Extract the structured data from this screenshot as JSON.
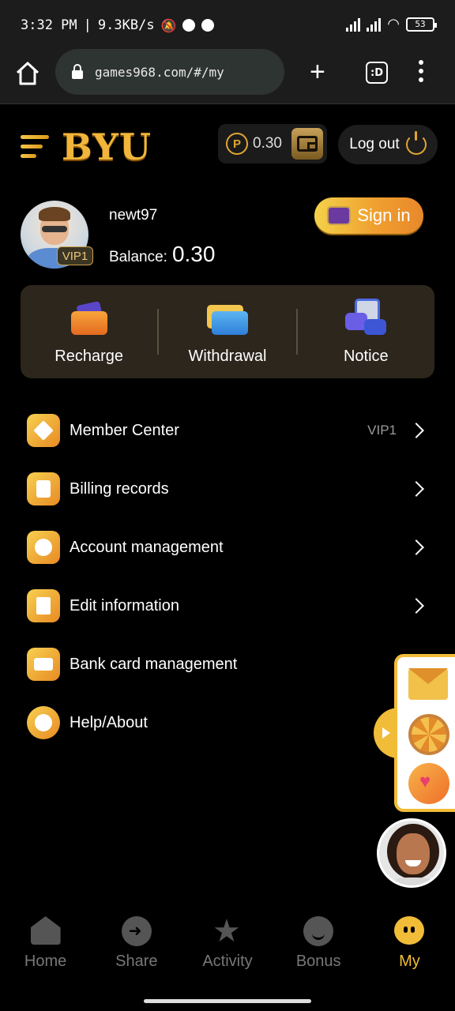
{
  "status_bar": {
    "time": "3:32 PM",
    "speed": "9.3KB/s",
    "battery": "53"
  },
  "browser": {
    "url": "games968.com/#/my",
    "tab_count": ":D"
  },
  "header": {
    "logo": "BYU",
    "coin_symbol": "P",
    "coin_balance": "0.30",
    "logout_label": "Log out"
  },
  "profile": {
    "username": "newt97",
    "vip_level": "VIP1",
    "balance_label": "Balance:",
    "balance_value": "0.30",
    "signin_label": "Sign in"
  },
  "quick_actions": [
    {
      "label": "Recharge",
      "icon": "wallet-icon"
    },
    {
      "label": "Withdrawal",
      "icon": "cards-icon"
    },
    {
      "label": "Notice",
      "icon": "notice-icon"
    }
  ],
  "menu": [
    {
      "label": "Member Center",
      "extra": "VIP1",
      "chevron": true,
      "icon": "diamond-icon"
    },
    {
      "label": "Billing records",
      "extra": "",
      "chevron": true,
      "icon": "clipboard-icon"
    },
    {
      "label": "Account management",
      "extra": "",
      "chevron": true,
      "icon": "user-icon"
    },
    {
      "label": "Edit information",
      "extra": "",
      "chevron": true,
      "icon": "document-icon"
    },
    {
      "label": "Bank card management",
      "extra": "",
      "chevron": false,
      "icon": "bank-card-icon"
    },
    {
      "label": "Help/About",
      "extra": "",
      "chevron": false,
      "icon": "info-icon"
    }
  ],
  "bottom_nav": [
    {
      "label": "Home",
      "active": false
    },
    {
      "label": "Share",
      "active": false
    },
    {
      "label": "Activity",
      "active": false
    },
    {
      "label": "Bonus",
      "active": false
    },
    {
      "label": "My",
      "active": true
    }
  ],
  "colors": {
    "accent": "#f1bd38",
    "panel": "#2d261d",
    "inactive_nav": "#777777"
  }
}
